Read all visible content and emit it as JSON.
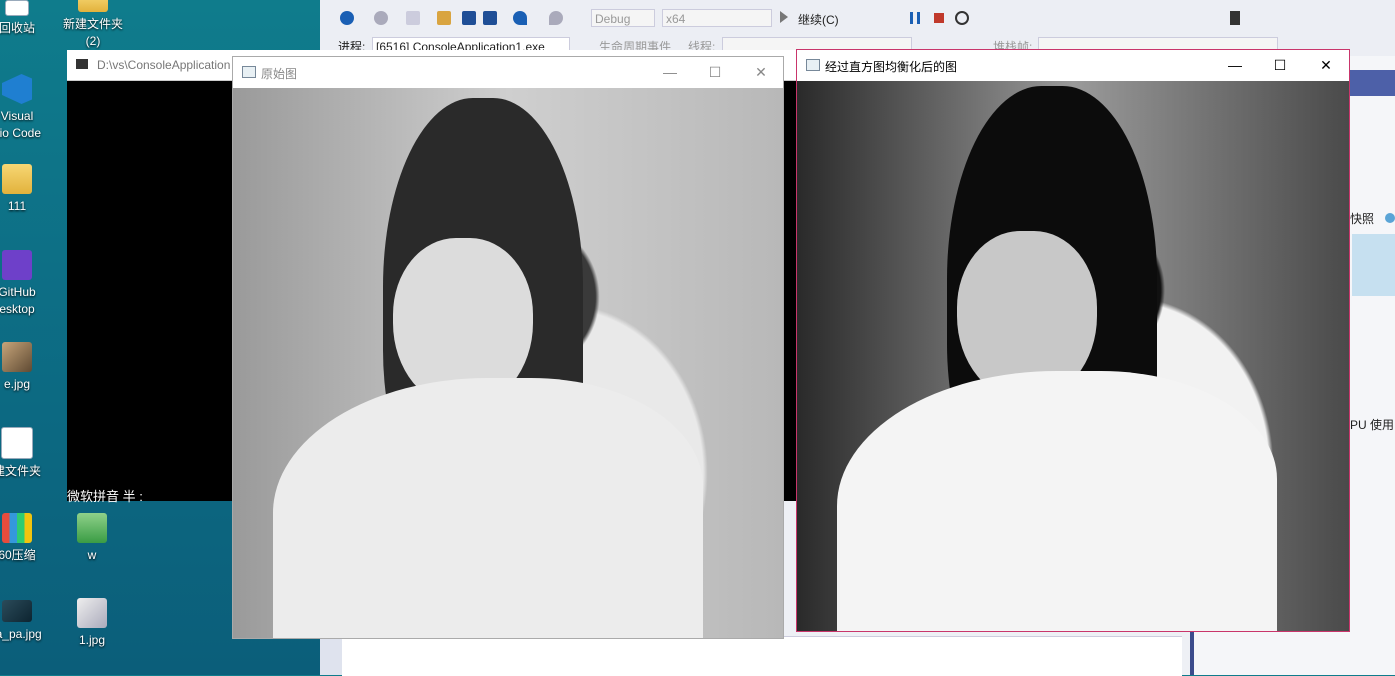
{
  "desktop": {
    "icons": [
      {
        "label": "回收站",
        "icon": "recycle-bin-icon"
      },
      {
        "label": "新建文件夹\n(2)",
        "icon": "folder-icon"
      },
      {
        "label": "Visual\ndio Code",
        "icon": "vscode-icon"
      },
      {
        "label": "111",
        "icon": "folder-icon"
      },
      {
        "label": "GitHub\nesktop",
        "icon": "github-icon"
      },
      {
        "label": "e.jpg",
        "icon": "image-icon"
      },
      {
        "label": "建文件夹",
        "icon": "document-icon"
      },
      {
        "label": "60压缩",
        "icon": "zip-icon"
      },
      {
        "label": "w",
        "icon": "folder-icon"
      },
      {
        "label": "ta_pa.jpg",
        "icon": "image-icon"
      },
      {
        "label": "1.jpg",
        "icon": "image-icon"
      }
    ]
  },
  "vs": {
    "toolbar": {
      "config": "Debug",
      "platform": "x64",
      "continue_label": "继续(C)"
    },
    "toolbar2": {
      "process_label": "进程:",
      "process_value": "[6516] ConsoleApplication1.exe",
      "lifecycle_label": "生命周期事件",
      "thread_label": "线程:",
      "stackframe_label": "堆栈帧:"
    },
    "right_panel": {
      "snapshot_label": "快照",
      "cpu_label": "PU 使用"
    }
  },
  "console": {
    "title": "D:\\vs\\ConsoleApplication",
    "ime_status": "微软拼音 半 :"
  },
  "window_original": {
    "title": "原始图"
  },
  "window_equalized": {
    "title": "经过直方图均衡化后的图"
  },
  "controls": {
    "minimize": "—",
    "maximize": "☐",
    "close": "✕"
  }
}
